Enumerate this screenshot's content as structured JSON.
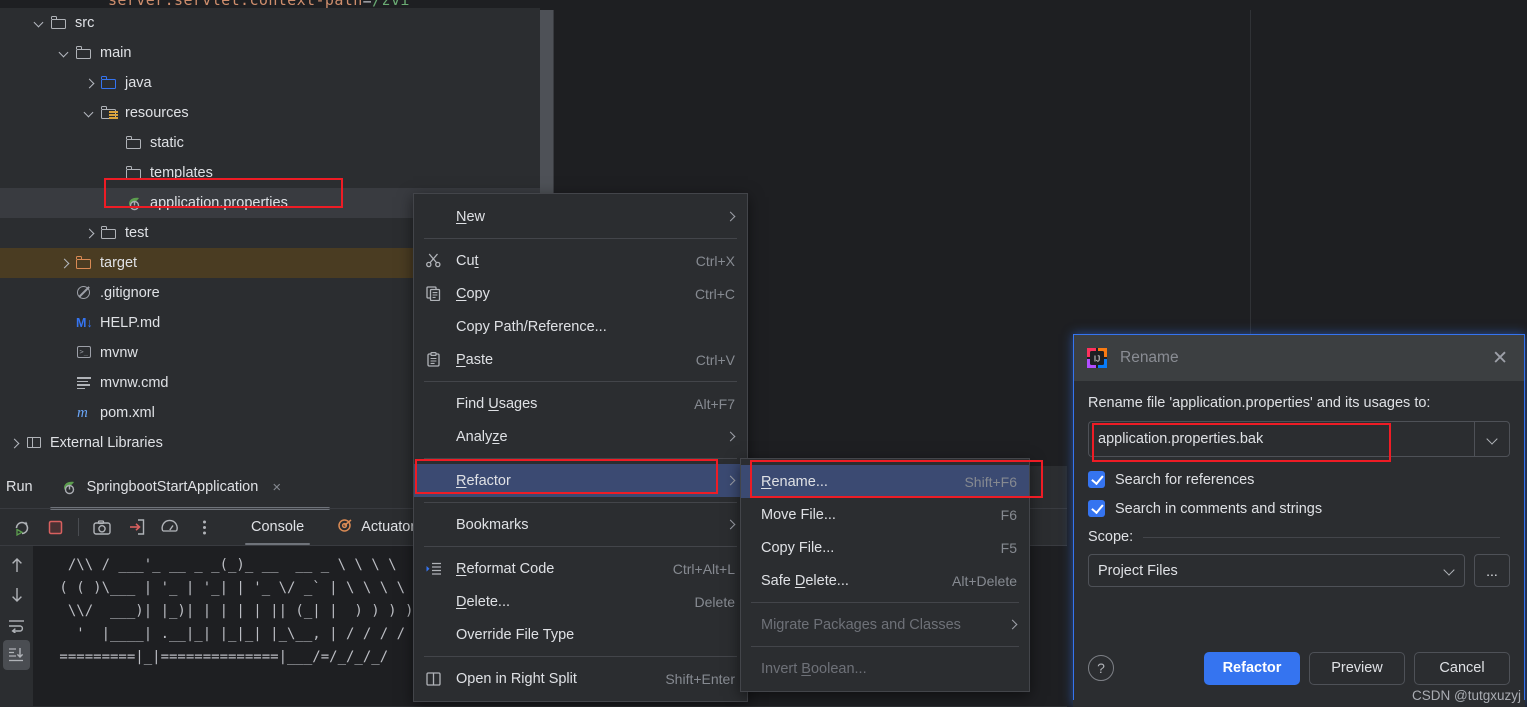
{
  "editor": {
    "line": {
      "key": "server.servlet.context-path",
      "eq": "=",
      "value": "/zvi"
    }
  },
  "project_tree": {
    "items": [
      {
        "label": "src",
        "icon": "folder-icon",
        "depth": 1,
        "chevron": "open",
        "state": "normal"
      },
      {
        "label": "main",
        "icon": "folder-icon",
        "depth": 2,
        "chevron": "open",
        "state": "normal"
      },
      {
        "label": "java",
        "icon": "folder-blue-icon",
        "depth": 3,
        "chevron": "closed",
        "state": "normal"
      },
      {
        "label": "resources",
        "icon": "folder-resources-icon",
        "depth": 3,
        "chevron": "open",
        "state": "normal"
      },
      {
        "label": "static",
        "icon": "folder-icon",
        "depth": 4,
        "chevron": "none",
        "state": "normal"
      },
      {
        "label": "templates",
        "icon": "folder-icon",
        "depth": 4,
        "chevron": "none",
        "state": "normal"
      },
      {
        "label": "application.properties",
        "icon": "spring-leaf-icon",
        "depth": 4,
        "chevron": "none",
        "state": "selected"
      },
      {
        "label": "test",
        "icon": "folder-icon",
        "depth": 3,
        "chevron": "closed",
        "state": "normal"
      },
      {
        "label": "target",
        "icon": "folder-orange-icon",
        "depth": 2,
        "chevron": "closed",
        "state": "excluded"
      },
      {
        "label": ".gitignore",
        "icon": "gitignore-icon",
        "depth": 2,
        "chevron": "none",
        "state": "normal"
      },
      {
        "label": "HELP.md",
        "icon": "markdown-icon",
        "depth": 2,
        "chevron": "none",
        "state": "normal"
      },
      {
        "label": "mvnw",
        "icon": "terminal-icon",
        "depth": 2,
        "chevron": "none",
        "state": "normal"
      },
      {
        "label": "mvnw.cmd",
        "icon": "text-lines-icon",
        "depth": 2,
        "chevron": "none",
        "state": "normal"
      },
      {
        "label": "pom.xml",
        "icon": "maven-icon",
        "depth": 2,
        "chevron": "none",
        "state": "normal"
      },
      {
        "label": "External Libraries",
        "icon": "library-icon",
        "depth": 0,
        "chevron": "closed",
        "state": "normal"
      }
    ]
  },
  "context_menu": {
    "items": [
      {
        "label": "New",
        "mnemonic": "N",
        "accel": "",
        "icon": "",
        "arrow": true,
        "selected": false,
        "disabled": false
      },
      {
        "separator": true
      },
      {
        "label": "Cut",
        "mnemonic": "t",
        "accel": "Ctrl+X",
        "icon": "scissors-icon",
        "arrow": false,
        "selected": false,
        "disabled": false
      },
      {
        "label": "Copy",
        "mnemonic": "C",
        "accel": "Ctrl+C",
        "icon": "copy-icon",
        "arrow": false,
        "selected": false,
        "disabled": false
      },
      {
        "label": "Copy Path/Reference...",
        "mnemonic": "",
        "accel": "",
        "icon": "",
        "arrow": false,
        "selected": false,
        "disabled": false
      },
      {
        "label": "Paste",
        "mnemonic": "P",
        "accel": "Ctrl+V",
        "icon": "paste-icon",
        "arrow": false,
        "selected": false,
        "disabled": false
      },
      {
        "separator": true
      },
      {
        "label": "Find Usages",
        "mnemonic": "U",
        "accel": "Alt+F7",
        "icon": "",
        "arrow": false,
        "selected": false,
        "disabled": false
      },
      {
        "label": "Analyze",
        "mnemonic": "z",
        "accel": "",
        "icon": "",
        "arrow": true,
        "selected": false,
        "disabled": false
      },
      {
        "separator": true
      },
      {
        "label": "Refactor",
        "mnemonic": "R",
        "accel": "",
        "icon": "",
        "arrow": true,
        "selected": true,
        "disabled": false
      },
      {
        "separator": true
      },
      {
        "label": "Bookmarks",
        "mnemonic": "",
        "accel": "",
        "icon": "",
        "arrow": true,
        "selected": false,
        "disabled": false
      },
      {
        "separator": true
      },
      {
        "label": "Reformat Code",
        "mnemonic": "R",
        "accel": "Ctrl+Alt+L",
        "icon": "reformat-icon",
        "arrow": false,
        "selected": false,
        "disabled": false
      },
      {
        "label": "Delete...",
        "mnemonic": "D",
        "accel": "Delete",
        "icon": "",
        "arrow": false,
        "selected": false,
        "disabled": false
      },
      {
        "label": "Override File Type",
        "mnemonic": "",
        "accel": "",
        "icon": "",
        "arrow": false,
        "selected": false,
        "disabled": false
      },
      {
        "separator": true
      },
      {
        "label": "Open in Right Split",
        "mnemonic": "",
        "accel": "Shift+Enter",
        "icon": "split-icon",
        "arrow": false,
        "selected": false,
        "disabled": false
      }
    ]
  },
  "refactor_submenu": {
    "items": [
      {
        "label": "Rename...",
        "mnemonic": "R",
        "accel": "Shift+F6",
        "arrow": false,
        "selected": true,
        "disabled": false
      },
      {
        "label": "Move File...",
        "mnemonic": "",
        "accel": "F6",
        "arrow": false,
        "selected": false,
        "disabled": false
      },
      {
        "label": "Copy File...",
        "mnemonic": "",
        "accel": "F5",
        "arrow": false,
        "selected": false,
        "disabled": false
      },
      {
        "label": "Safe Delete...",
        "mnemonic": "D",
        "accel": "Alt+Delete",
        "arrow": false,
        "selected": false,
        "disabled": false
      },
      {
        "separator": true
      },
      {
        "label": "Migrate Packages and Classes",
        "mnemonic": "",
        "accel": "",
        "arrow": true,
        "selected": false,
        "disabled": true
      },
      {
        "separator": true
      },
      {
        "label": "Invert Boolean...",
        "mnemonic": "B",
        "accel": "",
        "arrow": false,
        "selected": false,
        "disabled": true
      }
    ]
  },
  "run_panel": {
    "title": "Run",
    "config_name": "SpringbootStartApplication",
    "close_glyph": "×",
    "toolbar_icons": [
      "rerun-icon",
      "stop-icon",
      "camera-icon",
      "export-icon",
      "gauge-icon",
      "more-options-icon"
    ],
    "tabs": [
      {
        "label": "Console",
        "icon": "",
        "active": true
      },
      {
        "label": "Actuator",
        "icon": "actuator-icon",
        "active": false
      }
    ],
    "gutter_icons": [
      "scroll-up-icon",
      "scroll-down-icon",
      "soft-wrap-icon",
      "scroll-to-end-icon"
    ],
    "console_banner": "  /\\\\ / ___'_ __ _ _(_)_ __  __ _ \\ \\ \\ \\\n ( ( )\\___ | '_ | '_| | '_ \\/ _` | \\ \\ \\ \\\n  \\\\/  ___)| |_)| | | | | || (_| |  ) ) ) )\n   '  |____| .__|_| |_|_| |_\\__, | / / / /\n =========|_|==============|___/=/_/_/_/"
  },
  "rename_dialog": {
    "title": "Rename",
    "close_glyph": "✕",
    "prompt": "Rename file 'application.properties' and its usages to:",
    "input_value": "application.properties.bak",
    "checkboxes": [
      {
        "label": "Search for references",
        "checked": true
      },
      {
        "label": "Search in comments and strings",
        "checked": true
      }
    ],
    "scope_label": "Scope:",
    "scope_value": "Project Files",
    "scope_more": "...",
    "help_glyph": "?",
    "buttons": [
      {
        "label": "Refactor",
        "style": "primary"
      },
      {
        "label": "Preview",
        "style": "ghost"
      },
      {
        "label": "Cancel",
        "style": "ghost"
      }
    ]
  },
  "watermark": {
    "text": "CSDN @tutgxuzyj"
  },
  "colors": {
    "accent_blue": "#3574f0",
    "menu_selection": "#3b4a72",
    "annotation_red": "#ee1c25",
    "excluded_folder": "#4a3c22",
    "panel_bg": "#2b2d30",
    "editor_bg": "#1e1f22"
  }
}
